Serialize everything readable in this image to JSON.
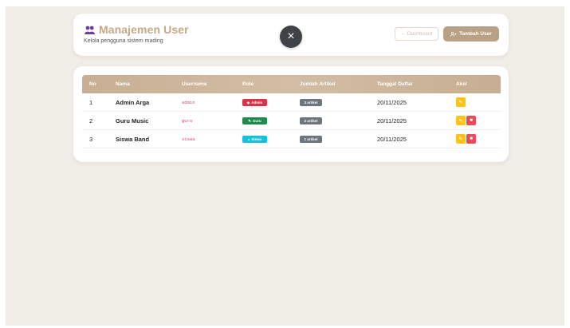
{
  "header": {
    "title": "Manajemen User",
    "subtitle": "Kelola pengguna sistem mading",
    "title_icon": "users-icon",
    "close_label": "×",
    "dashboard_label": "← Dashboard",
    "add_user_label": "Tambah User",
    "add_user_icon": "user-plus-icon"
  },
  "table": {
    "columns": [
      "No",
      "Nama",
      "Username",
      "Role",
      "Jumlah Artikel",
      "Tanggal Daftar",
      "Aksi"
    ],
    "rows": [
      {
        "no": "1",
        "name": "Admin Arga",
        "username": "admin",
        "role": "Admin",
        "role_icon": "shield-icon",
        "articles": "3 artikel",
        "date": "20/11/2025",
        "actions": [
          "edit"
        ]
      },
      {
        "no": "2",
        "name": "Guru Music",
        "username": "guru",
        "role": "Guru",
        "role_icon": "pencil-icon",
        "articles": "2 artikel",
        "date": "20/11/2025",
        "actions": [
          "edit",
          "delete"
        ]
      },
      {
        "no": "3",
        "name": "Siswa Band",
        "username": "siswa",
        "role": "Siswa",
        "role_icon": "graduation-cap-icon",
        "articles": "1 artikel",
        "date": "20/11/2025",
        "actions": [
          "edit",
          "delete"
        ]
      }
    ]
  },
  "colors": {
    "accent": "#b8a184",
    "title": "#c4a888",
    "admin": "#d9334a",
    "guru": "#1f8a4c",
    "siswa": "#17c1dd",
    "edit": "#ffc215",
    "delete": "#eb4b59",
    "count": "#6d757d"
  }
}
